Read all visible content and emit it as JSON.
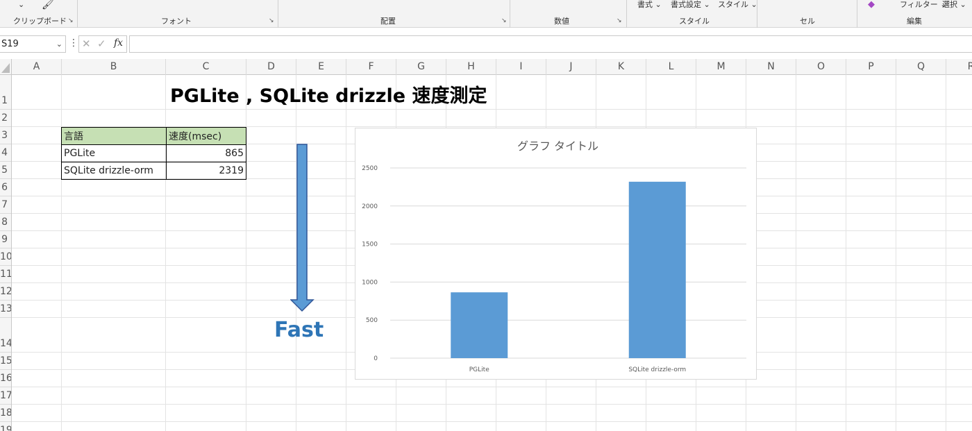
{
  "ribbon": {
    "top_items": [
      "書式",
      "書式設定",
      "スタイル",
      "フィルター",
      "選択"
    ],
    "groups": [
      {
        "label": "クリップボード"
      },
      {
        "label": "フォント"
      },
      {
        "label": "配置"
      },
      {
        "label": "数値"
      },
      {
        "label": "スタイル"
      },
      {
        "label": "セル"
      },
      {
        "label": "編集"
      }
    ]
  },
  "formula_bar": {
    "name_box": "S19",
    "fx_label": "fx",
    "content": ""
  },
  "columns": [
    "A",
    "B",
    "C",
    "D",
    "E",
    "F",
    "G",
    "H",
    "I",
    "J",
    "K",
    "L",
    "M",
    "N",
    "O",
    "P",
    "Q",
    "R"
  ],
  "rows": [
    "1",
    "2",
    "3",
    "4",
    "5",
    "6",
    "7",
    "8",
    "9",
    "10",
    "11",
    "12",
    "13",
    "14",
    "15",
    "16",
    "17",
    "18",
    "19"
  ],
  "sheet": {
    "title": "PGLite , SQLite drizzle 速度測定",
    "table": {
      "headers": [
        "言語",
        "速度(msec)"
      ],
      "rows": [
        {
          "name": "PGLite",
          "value": "865"
        },
        {
          "name": "SQLite drizzle-orm",
          "value": "2319"
        }
      ]
    },
    "arrow_label": "Fast"
  },
  "chart_data": {
    "type": "bar",
    "title": "グラフ タイトル",
    "categories": [
      "PGLite",
      "SQLite drizzle-orm"
    ],
    "values": [
      865,
      2319
    ],
    "ylim": [
      0,
      2500
    ],
    "yticks": [
      0,
      500,
      1000,
      1500,
      2000,
      2500
    ],
    "grid": true,
    "color": "#5b9bd5"
  }
}
